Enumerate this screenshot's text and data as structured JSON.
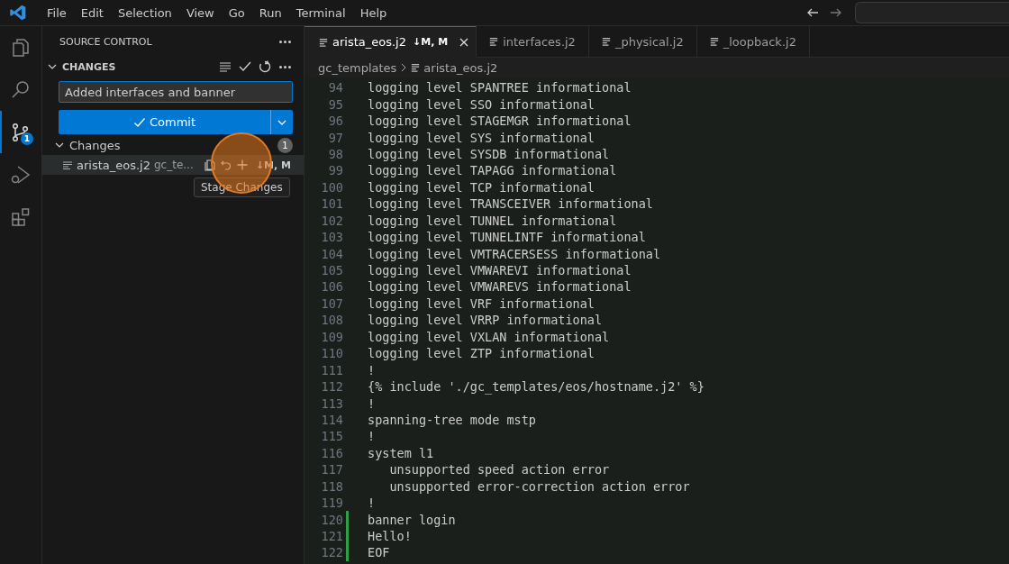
{
  "menu": [
    "File",
    "Edit",
    "Selection",
    "View",
    "Go",
    "Run",
    "Terminal",
    "Help"
  ],
  "activity_bar": [
    {
      "selected": false
    },
    {
      "selected": false
    },
    {
      "selected": true,
      "badge": "1"
    },
    {
      "selected": false
    },
    {
      "selected": false
    }
  ],
  "sidebar": {
    "title": "SOURCE CONTROL",
    "section": "CHANGES",
    "expanded": true,
    "commit_message": "Added interfaces and banner",
    "commit_button": "Commit",
    "group": {
      "label": "Changes",
      "count": "1",
      "expanded": true
    },
    "files": [
      {
        "name": "arista_eos.j2",
        "path": "gc_te...",
        "status": "↓M, M",
        "selected": true
      }
    ],
    "tooltip": "Stage Changes"
  },
  "tabs": [
    {
      "label": "arista_eos.j2",
      "status": "↓M, M",
      "selected": true
    },
    {
      "label": "interfaces.j2",
      "selected": false
    },
    {
      "label": "_physical.j2",
      "selected": false
    },
    {
      "label": "_loopback.j2",
      "selected": false
    }
  ],
  "breadcrumb": [
    "gc_templates",
    "arista_eos.j2"
  ],
  "lines": [
    {
      "n": "94",
      "text": "logging level SPANTREE informational",
      "added": false
    },
    {
      "n": "95",
      "text": "logging level SSO informational",
      "added": false
    },
    {
      "n": "96",
      "text": "logging level STAGEMGR informational",
      "added": false
    },
    {
      "n": "97",
      "text": "logging level SYS informational",
      "added": false
    },
    {
      "n": "98",
      "text": "logging level SYSDB informational",
      "added": false
    },
    {
      "n": "99",
      "text": "logging level TAPAGG informational",
      "added": false
    },
    {
      "n": "100",
      "text": "logging level TCP informational",
      "added": false
    },
    {
      "n": "101",
      "text": "logging level TRANSCEIVER informational",
      "added": false
    },
    {
      "n": "102",
      "text": "logging level TUNNEL informational",
      "added": false
    },
    {
      "n": "103",
      "text": "logging level TUNNELINTF informational",
      "added": false
    },
    {
      "n": "104",
      "text": "logging level VMTRACERSESS informational",
      "added": false
    },
    {
      "n": "105",
      "text": "logging level VMWAREVI informational",
      "added": false
    },
    {
      "n": "106",
      "text": "logging level VMWAREVS informational",
      "added": false
    },
    {
      "n": "107",
      "text": "logging level VRF informational",
      "added": false
    },
    {
      "n": "108",
      "text": "logging level VRRP informational",
      "added": false
    },
    {
      "n": "109",
      "text": "logging level VXLAN informational",
      "added": false
    },
    {
      "n": "110",
      "text": "logging level ZTP informational",
      "added": false
    },
    {
      "n": "111",
      "text": "!",
      "added": false
    },
    {
      "n": "112",
      "text": "{% include './gc_templates/eos/hostname.j2' %}",
      "added": false
    },
    {
      "n": "113",
      "text": "!",
      "added": false
    },
    {
      "n": "114",
      "text": "spanning-tree mode mstp",
      "added": false
    },
    {
      "n": "115",
      "text": "!",
      "added": false
    },
    {
      "n": "116",
      "text": "system l1",
      "added": false
    },
    {
      "n": "117",
      "text": "   unsupported speed action error",
      "added": false
    },
    {
      "n": "118",
      "text": "   unsupported error-correction action error",
      "added": false
    },
    {
      "n": "119",
      "text": "!",
      "added": false
    },
    {
      "n": "120",
      "text": "banner login",
      "added": true
    },
    {
      "n": "121",
      "text": "Hello!",
      "added": true
    },
    {
      "n": "122",
      "text": "EOF",
      "added": true
    }
  ]
}
